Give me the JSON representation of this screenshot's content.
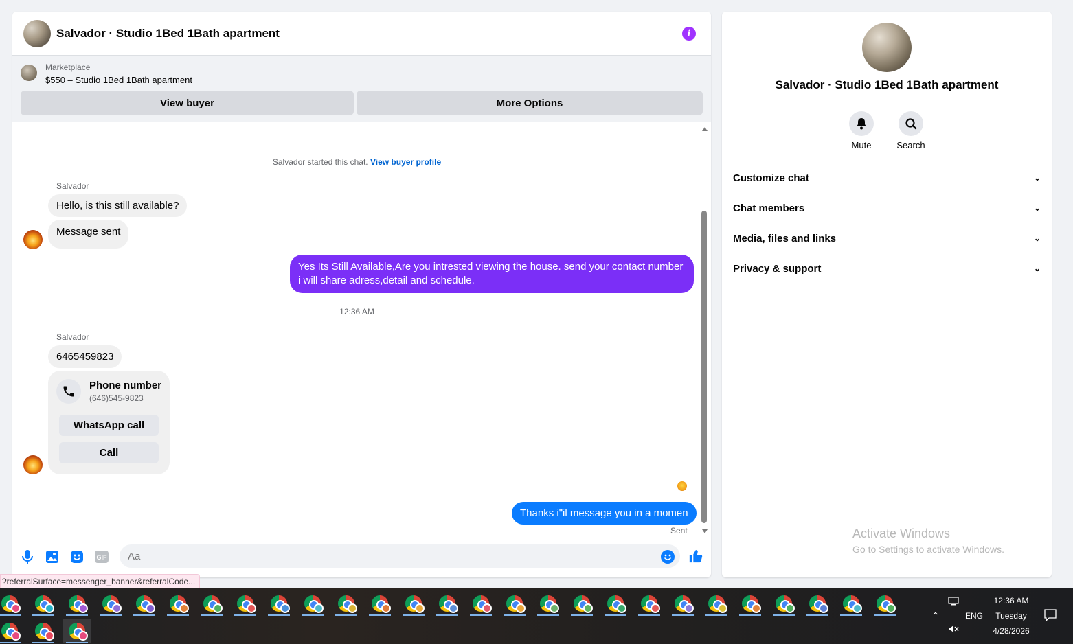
{
  "chat": {
    "title": "Salvador · Studio 1Bed 1Bath apartment",
    "marketplace_label": "Marketplace",
    "listing": "$550 – Studio 1Bed 1Bath apartment",
    "view_buyer_label": "View buyer",
    "more_options_label": "More Options",
    "system_text": "Salvador started this chat.",
    "view_profile_link": "View buyer profile",
    "sender_name_1": "Salvador",
    "msg_1": "Hello, is this still available?",
    "msg_2": "Message sent",
    "out_msg_1": "Yes Its Still Available,Are you intrested viewing the house. send your contact number i will share adress,detail and schedule.",
    "timestamp": "12:36 AM",
    "sender_name_2": "Salvador",
    "msg_3": "6465459823",
    "phone_card": {
      "title": "Phone number",
      "number": "(646)545-9823",
      "whatsapp_label": "WhatsApp call",
      "call_label": "Call"
    },
    "out_msg_2": "Thanks i\"il message you in a momen",
    "sent_status": "Sent",
    "input_placeholder": "Aa",
    "accent_color": "#7b2ff7",
    "out_blue_color": "#0a7cff"
  },
  "info_panel": {
    "title": "Salvador · Studio 1Bed 1Bath apartment",
    "mute_label": "Mute",
    "search_label": "Search",
    "menu": [
      {
        "label": "Customize chat",
        "icon": "chevron-down-icon"
      },
      {
        "label": "Chat members",
        "icon": "chevron-down-icon"
      },
      {
        "label": "Media, files and links",
        "icon": "chevron-down-icon"
      },
      {
        "label": "Privacy & support",
        "icon": "chevron-down-icon"
      }
    ],
    "watermark_title": "Activate Windows",
    "watermark_sub": "Go to Settings to activate Windows."
  },
  "status_url": "?referralSurface=messenger_banner&referralCode...",
  "taskbar": {
    "language": "ENG",
    "time": "12:36 AM",
    "day": "Tuesday",
    "date": "4/28/2026",
    "badge_colors": [
      "#e84a7f",
      "#27b3c9",
      "#a25bd6",
      "#8f6dd8",
      "#7d5fd1",
      "#e0823a",
      "#4fb05d",
      "#e45757",
      "#4a8fd9",
      "#4db9c7",
      "#d9b437",
      "#e07a3a",
      "#e8a93c",
      "#5c8fd8",
      "#e25a6a",
      "#eaa83c",
      "#6cb26c",
      "#5fb35f",
      "#37a86b",
      "#e25757",
      "#8e7ad6",
      "#d9c237",
      "#e0823a",
      "#4fb05d",
      "#5b7fd6",
      "#4db9c7",
      "#4fb05d",
      "#e84a7f",
      "#e84a5f",
      "#e84a7f"
    ]
  }
}
